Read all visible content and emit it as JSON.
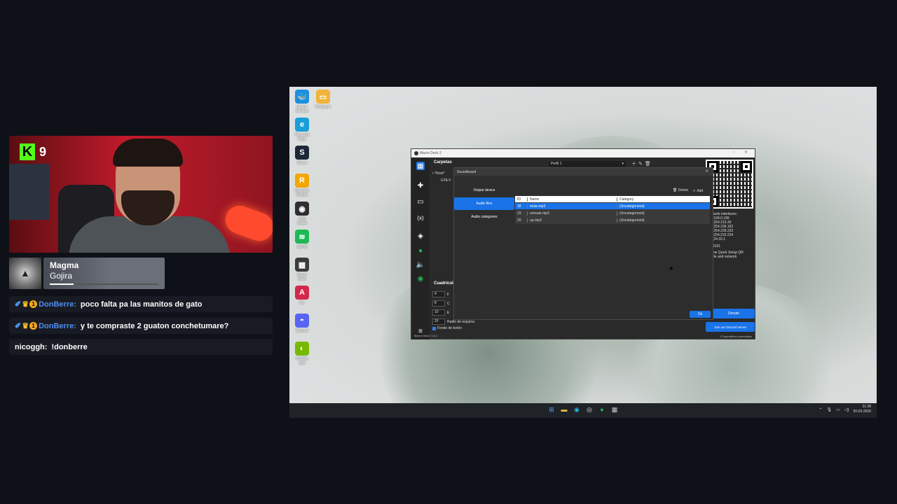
{
  "stream": {
    "kick_count": "9",
    "now_playing": {
      "song": "Magma",
      "artist": "Gojira",
      "progress": 0.22
    },
    "chat": [
      {
        "user": "DonBerre:",
        "user_color": "#4e8df2",
        "badges": true,
        "text": "poco falta pa las manitos de gato"
      },
      {
        "user": "DonBerre:",
        "user_color": "#4e8df2",
        "badges": true,
        "text": "y te compraste 2 guaton conchetumare?"
      },
      {
        "user": "nicoggh:",
        "user_color": "#ffffff",
        "badges": false,
        "text": "!donberre"
      }
    ],
    "badge_number": "1"
  },
  "desktop": {
    "icons": [
      {
        "label": "Docker Desktop",
        "color": "#1d8fe1",
        "glyph": "🐳",
        "icon": "docker-icon"
      },
      {
        "label": "Wallpaper",
        "color": "#f0b43c",
        "glyph": "▭",
        "icon": "folder-icon"
      },
      {
        "label": "Microsoft Edge",
        "color": "#1a9fd8",
        "glyph": "e",
        "icon": "edge-icon"
      },
      {
        "label": "Steam",
        "color": "#1b2838",
        "glyph": "S",
        "icon": "steam-icon"
      },
      {
        "label": "Rockstar Games",
        "color": "#f3a600",
        "glyph": "R",
        "icon": "rockstar-icon"
      },
      {
        "label": "OBS Studio",
        "color": "#302e31",
        "glyph": "◉",
        "icon": "obs-icon"
      },
      {
        "label": "Spotify",
        "color": "#1db954",
        "glyph": "≋",
        "icon": "spotify-icon"
      },
      {
        "label": "Macro Deck",
        "color": "#3b3b3b",
        "glyph": "▦",
        "icon": "macro-deck-icon"
      },
      {
        "label": "Arc",
        "color": "#d2294c",
        "glyph": "A",
        "icon": "arc-icon"
      },
      {
        "label": "Discord",
        "color": "#5865f2",
        "glyph": "◓",
        "icon": "discord-icon"
      },
      {
        "label": "NVIDIA App",
        "color": "#76b900",
        "glyph": "◐",
        "icon": "nvidia-icon"
      }
    ],
    "clock_time": "21:38",
    "clock_date": "30-03-2026"
  },
  "macrodeck": {
    "title": "Macro Deck 2",
    "folders_label": "Carpetas",
    "profile": "Perfil 1",
    "tree_root": "*Root*",
    "tree_child": "GTA V",
    "grid_label": "Cuadrícula",
    "settings": [
      {
        "value": "4",
        "label": "F"
      },
      {
        "value": "8",
        "label": "C"
      },
      {
        "value": "10",
        "label": "E"
      },
      {
        "value": "20",
        "label": "Radio de esquina"
      }
    ],
    "background_check": "Fondo de botón",
    "info_lines": [
      "work interfaces:",
      ".168.0.189",
      ".254.219.39",
      ".254.239.162",
      ".254.228.233",
      ".254.210.234",
      ".24.32.1",
      "8191",
      "ow Quick Setup QR",
      "de and network"
    ],
    "donate": "Donate",
    "discord": "Join our Discord server",
    "version": "Macro Deck 2.14.1",
    "devices": "1 Dispositivos conectados"
  },
  "soundboard": {
    "title": "Soundboard",
    "nav": [
      "Output device",
      "Audio files",
      "Audio categories"
    ],
    "active_nav": 1,
    "delete_label": "Delete",
    "add_label": "Add",
    "columns": [
      "ID",
      "Name",
      "Category"
    ],
    "rows": [
      {
        "id": "18",
        "name": "mute.mp3",
        "category": "(Uncategorized)",
        "selected": true
      },
      {
        "id": "19",
        "name": "unmute.mp3",
        "category": "(Uncategorized)",
        "selected": false
      },
      {
        "id": "20",
        "name": "up.mp3",
        "category": "(Uncategorized)",
        "selected": false
      }
    ],
    "ok_label": "Ok"
  }
}
